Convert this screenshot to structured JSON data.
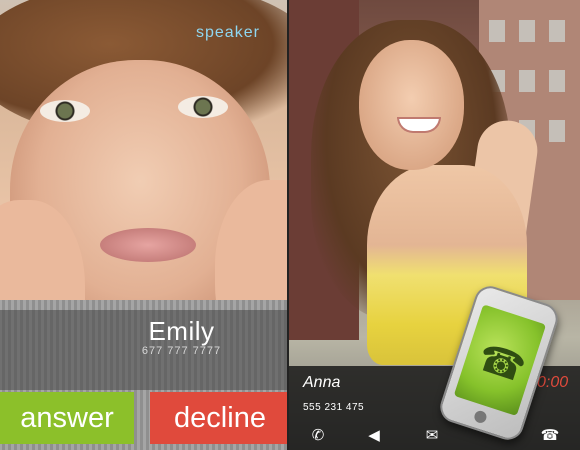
{
  "left_screen": {
    "speaker_label": "speaker",
    "caller_name": "Emily",
    "caller_number": "677 777 7777",
    "answer_label": "answer",
    "decline_label": "decline",
    "colors": {
      "answer": "#8cc02a",
      "decline": "#e04a3c",
      "speaker": "#8fd6f0"
    }
  },
  "right_screen": {
    "caller_name": "Anna",
    "caller_number": "555 231 475",
    "timer": "0:00",
    "icons": [
      "phone-icon",
      "speaker-icon",
      "mail-icon",
      "hangup-icon"
    ],
    "icon_glyphs": {
      "phone": "✆",
      "speaker": "◀",
      "mail": "✉",
      "hangup": "☎"
    }
  }
}
